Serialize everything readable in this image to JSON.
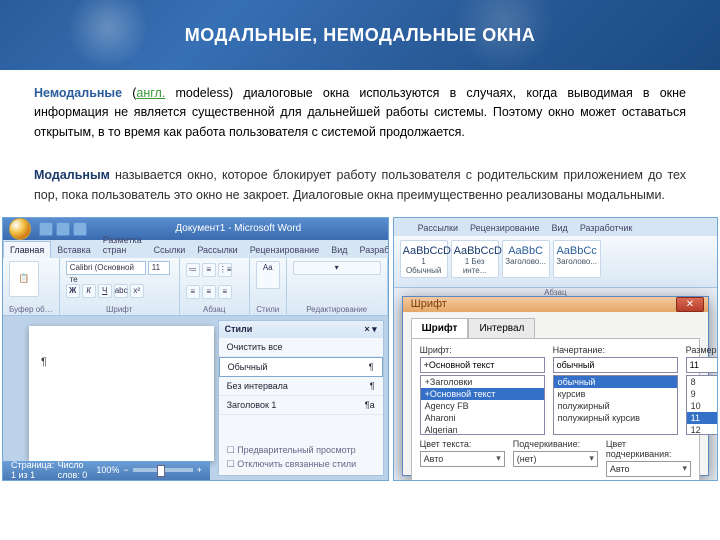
{
  "header": {
    "title": "МОДАЛЬНЫЕ, НЕМОДАЛЬНЫЕ ОКНА"
  },
  "para1": {
    "lead": "Немодальные",
    "paren_open": " (",
    "lang_link": "англ.",
    "after_lang": " modeless) диалоговые окна используются в случаях, когда выводимая в окне информация не является существенной для дальнейшей работы системы. Поэтому окно может оставаться открытым, в то время как работа пользователя с системой продолжается."
  },
  "para2": {
    "lead": "Модальным",
    "rest": " называется окно, которое блокирует работу пользователя с родительским приложением до тех пор, пока пользователь это окно не закроет. Диалоговые окна преимущественно реализованы модальными."
  },
  "left": {
    "title": "Документ1 - Microsoft Word",
    "tabs": [
      "Главная",
      "Вставка",
      "Разметка стран",
      "Ссылки",
      "Рассылки",
      "Рецензирование",
      "Вид",
      "Разработчик"
    ],
    "active_tab": 0,
    "font_name": "Calibri (Основной те",
    "font_size": "11",
    "groups": {
      "clipboard": "Буфер об…",
      "font": "Шрифт",
      "paragraph": "Абзац",
      "styles": "Стили",
      "editing": "Редактирование"
    },
    "styles_pane": {
      "title": "Стили",
      "clear": "Очистить все",
      "items": [
        "Обычный",
        "Без интервала",
        "Заголовок 1"
      ],
      "opt_preview": "Предварительный просмотр",
      "opt_linked": "Отключить связанные стили"
    },
    "status": {
      "page": "Страница: 1 из 1",
      "words": "Число слов: 0",
      "zoom": "100%"
    }
  },
  "right": {
    "tabs": [
      "Рассылки",
      "Рецензирование",
      "Вид",
      "Разработчик"
    ],
    "style_previews": [
      {
        "aa": "AaBbCcDc",
        "name": "1 Обычный"
      },
      {
        "aa": "AaBbCcDc",
        "name": "1 Без инте..."
      },
      {
        "aa": "AaBbC",
        "name": "Заголово..."
      },
      {
        "aa": "AaBbCc",
        "name": "Заголово..."
      }
    ],
    "group_label": "Абзац",
    "dialog": {
      "title": "Шрифт",
      "tabs": [
        "Шрифт",
        "Интервал"
      ],
      "font_label": "Шрифт:",
      "font_value": "+Основной текст",
      "font_list": [
        "+Заголовки",
        "+Основной текст",
        "Agency FB",
        "Aharoni",
        "Algerian"
      ],
      "style_label": "Начертание:",
      "style_value": "обычный",
      "style_list": [
        "обычный",
        "курсив",
        "полужирный",
        "полужирный курсив"
      ],
      "size_label": "Размер:",
      "size_value": "11",
      "size_list": [
        "8",
        "9",
        "10",
        "11",
        "12"
      ],
      "color_label": "Цвет текста:",
      "color_value": "Авто",
      "underline_label": "Подчеркивание:",
      "underline_value": "(нет)",
      "underline_color_label": "Цвет подчеркивания:",
      "underline_color_value": "Авто"
    }
  }
}
